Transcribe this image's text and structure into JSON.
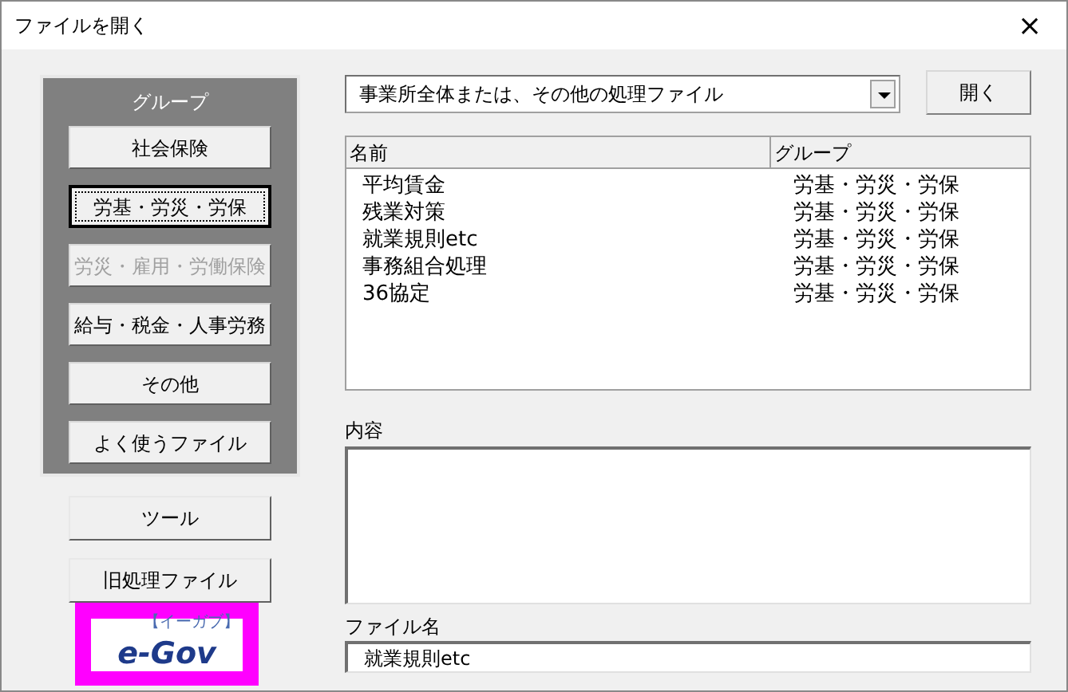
{
  "window": {
    "title": "ファイルを開く",
    "close": "×"
  },
  "group_panel": {
    "title": "グループ",
    "buttons": [
      {
        "label": "社会保険",
        "selected": false,
        "disabled": false
      },
      {
        "label": "労基・労災・労保",
        "selected": true,
        "disabled": false
      },
      {
        "label": "労災・雇用・労働保険",
        "selected": false,
        "disabled": true
      },
      {
        "label": "給与・税金・人事労務",
        "selected": false,
        "disabled": false
      },
      {
        "label": "その他",
        "selected": false,
        "disabled": false
      },
      {
        "label": "よく使うファイル",
        "selected": false,
        "disabled": false
      }
    ]
  },
  "tool_buttons": [
    "ツール",
    "旧処理ファイル"
  ],
  "egov_logo": {
    "text": "e-Gov",
    "reading": "【イーガブ】"
  },
  "category_select": {
    "value": "事業所全体または、その他の処理ファイル"
  },
  "open_button": "開く",
  "file_list": {
    "columns": [
      "名前",
      "グループ"
    ],
    "rows": [
      [
        "平均賃金",
        "労基・労災・労保"
      ],
      [
        "残業対策",
        "労基・労災・労保"
      ],
      [
        "就業規則etc",
        "労基・労災・労保"
      ],
      [
        "事務組合処理",
        "労基・労災・労保"
      ],
      [
        "36協定",
        "労基・労災・労保"
      ]
    ]
  },
  "description": {
    "label": "内容"
  },
  "file_name": {
    "label": "ファイル名",
    "value": "就業規則etc"
  }
}
